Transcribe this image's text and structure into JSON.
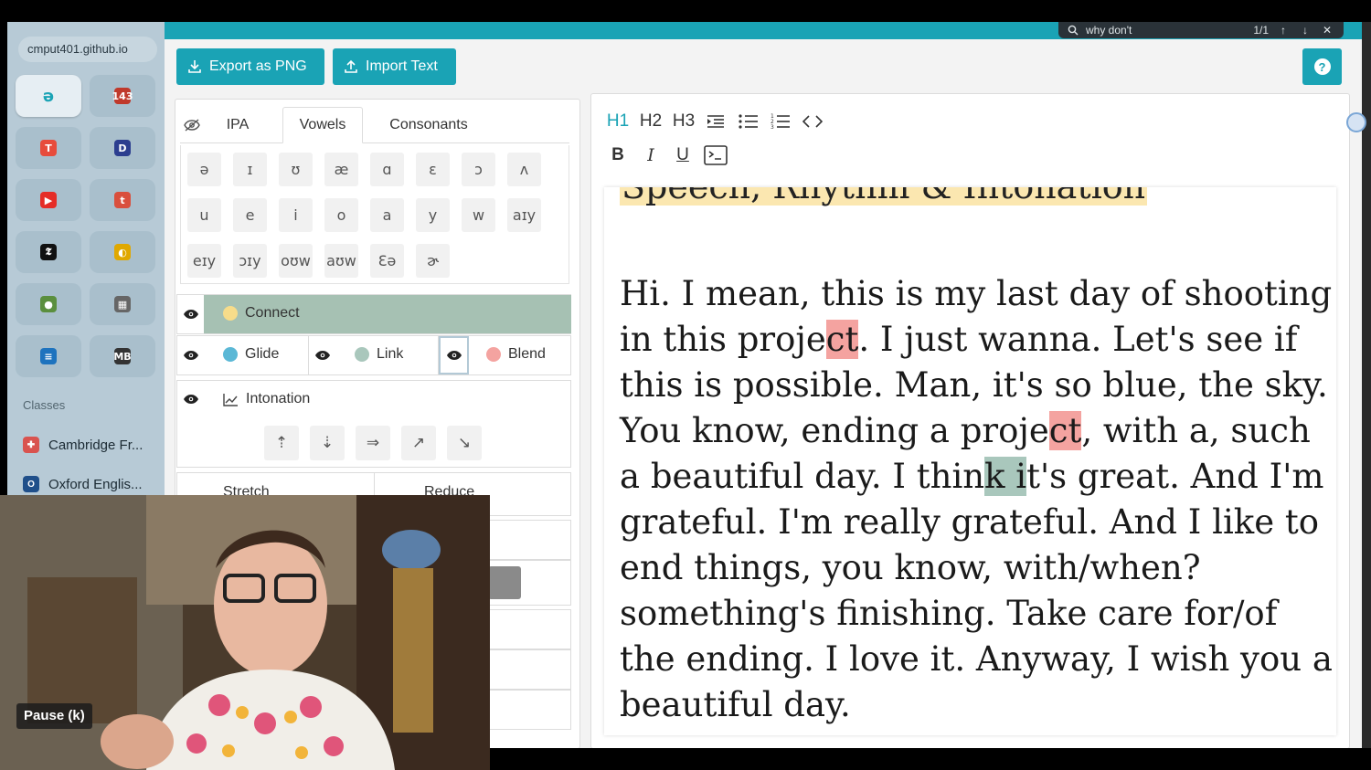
{
  "browser": {
    "url": "cmput401.github.io",
    "section_label": "Classes",
    "bookmarks": [
      {
        "label": "Cambridge Fr...",
        "color": "#d9534f",
        "glyph": "✚"
      },
      {
        "label": "Oxford Englis...",
        "color": "#1f4f8a",
        "glyph": "O"
      }
    ],
    "apps": [
      {
        "glyph": "ə",
        "color": "#1aa3b5",
        "active": true
      },
      {
        "glyph": "143",
        "color": "#c0392b"
      },
      {
        "glyph": "T",
        "color": "#e74c3c"
      },
      {
        "glyph": "D",
        "color": "#2c3e8f"
      },
      {
        "glyph": "▶",
        "color": "#e52d27"
      },
      {
        "glyph": "t",
        "color": "#d94f3d"
      },
      {
        "glyph": "𝕿",
        "color": "#111111"
      },
      {
        "glyph": "◐",
        "color": "#e0a800"
      },
      {
        "glyph": "●",
        "color": "#5b8f3e"
      },
      {
        "glyph": "▦",
        "color": "#666666"
      },
      {
        "glyph": "≡",
        "color": "#1e73be"
      },
      {
        "glyph": "MB",
        "color": "#333333"
      }
    ]
  },
  "find": {
    "query": "why don't",
    "count": "1/1"
  },
  "toolbar": {
    "export_label": "Export as PNG",
    "import_label": "Import Text",
    "help_label": "?"
  },
  "tabs": {
    "ipa": "IPA",
    "vowels": "Vowels",
    "consonants": "Consonants"
  },
  "vowels": [
    [
      "ə",
      "ɪ",
      "ʊ",
      "æ",
      "ɑ",
      "ɛ",
      "ɔ",
      "ʌ"
    ],
    [
      "u",
      "e",
      "i",
      "o",
      "a",
      "y",
      "w",
      "aɪy"
    ],
    [
      "eɪy",
      "ɔɪy",
      "oʊw",
      "aʊw",
      "Ɛə",
      "ɚ"
    ]
  ],
  "markers": {
    "connect": {
      "label": "Connect",
      "color": "#f7dc8a"
    },
    "glide": {
      "label": "Glide",
      "color": "#5bb8d6"
    },
    "link": {
      "label": "Link",
      "color": "#a9c7bc"
    },
    "blend": {
      "label": "Blend",
      "color": "#f4a3a0"
    },
    "intonation": {
      "label": "Intonation"
    },
    "stretch": {
      "label": "Stretch"
    },
    "reduce": {
      "label": "Reduce"
    }
  },
  "arrows": [
    "⇡",
    "⇣",
    "⇒",
    "↗",
    "↘"
  ],
  "editor": {
    "tools": {
      "h1": "H1",
      "h2": "H2",
      "h3": "H3",
      "bold": "B",
      "italic": "I",
      "underline": "U"
    },
    "title": "Speech, Rhythm & Intonation",
    "body": {
      "l1": "Hi. I mean, this is my last day of shooting",
      "l2a": "in this proje",
      "l2b": "ct",
      "l2c": ". I just wanna. Let's see if",
      "l3": "this is possible. Man, it's so blue, the sky.",
      "l4a": "You know, ending a proje",
      "l4b": "ct",
      "l4c": ", with a, such",
      "l5a": "a beautiful day. I thin",
      "l5b": "k i",
      "l5c": "t's great. And I'm",
      "l6": "grateful. I'm really grateful. And I like to",
      "l7": "end things, you know, with/when?",
      "l8": "something's finishing. Take care for/of",
      "l9": "the ending. I love it. Anyway, I wish you a",
      "l10": "beautiful day."
    }
  },
  "video": {
    "pause_tip": "Pause (k)"
  }
}
